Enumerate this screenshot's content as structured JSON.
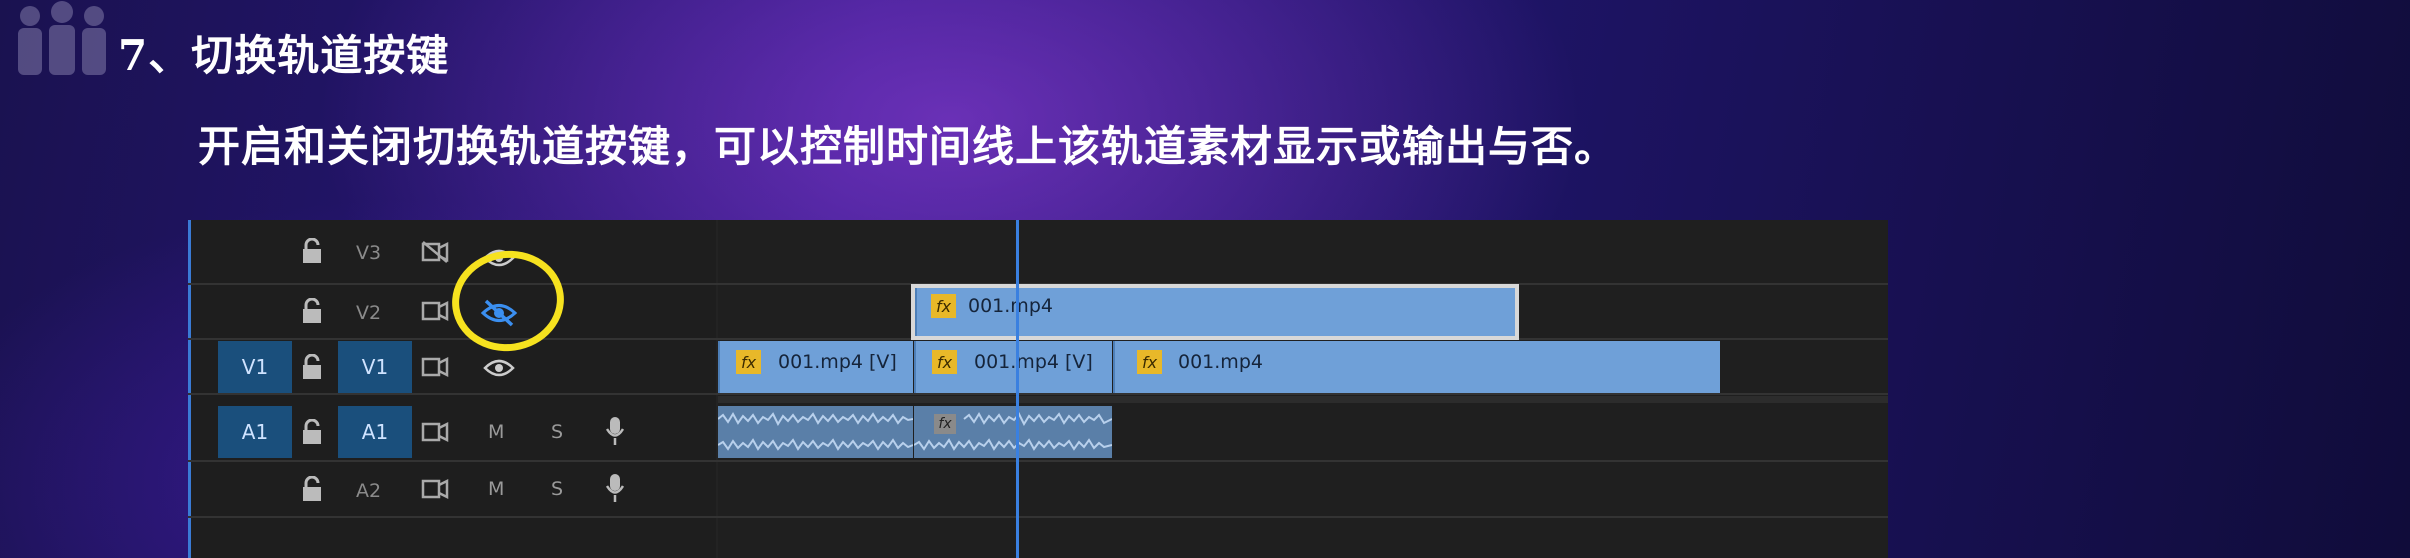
{
  "slide": {
    "heading": "7、切换轨道按键",
    "subheading": "开启和关闭切换轨道按键，可以控制时间线上该轨道素材显示或输出与否。",
    "logo_icon": "people-group-icon",
    "highlight_color": "#f6e21f"
  },
  "timeline": {
    "tracks": [
      {
        "id": "V3",
        "source": "",
        "label": "V3",
        "lock_icon": "unlock-icon",
        "sync_icon": "sync-lock-off-icon",
        "visibility_icon": "eye-icon"
      },
      {
        "id": "V2",
        "source": "",
        "label": "V2",
        "lock_icon": "unlock-icon",
        "sync_icon": "sync-lock-icon",
        "visibility_icon": "eye-hidden-icon"
      },
      {
        "id": "V1",
        "source": "V1",
        "label": "V1",
        "lock_icon": "unlock-icon",
        "sync_icon": "sync-lock-icon",
        "visibility_icon": "eye-icon"
      },
      {
        "id": "A1",
        "source": "A1",
        "label": "A1",
        "lock_icon": "unlock-icon",
        "sync_icon": "sync-lock-icon",
        "mute": "M",
        "solo": "S",
        "voice_icon": "microphone-icon"
      },
      {
        "id": "A2",
        "source": "",
        "label": "A2",
        "lock_icon": "unlock-icon",
        "sync_icon": "sync-lock-icon",
        "mute": "M",
        "solo": "S",
        "voice_icon": "microphone-icon"
      }
    ],
    "clips": {
      "v2_clip": {
        "fx": "fx",
        "name": "001.mp4"
      },
      "v1_clip1": {
        "fx": "fx",
        "name": "001.mp4 [V]"
      },
      "v1_clip2": {
        "fx": "fx",
        "name": "001.mp4 [V]"
      },
      "v1_clip3": {
        "fx": "fx",
        "name": "001.mp4"
      },
      "a1_clip2": {
        "fx": "fx"
      }
    }
  }
}
